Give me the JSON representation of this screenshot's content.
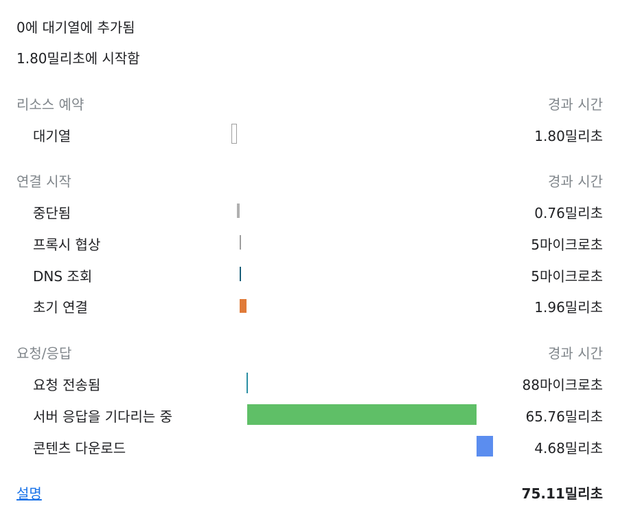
{
  "header": {
    "queued_at": "0에 대기열에 추가됨",
    "started_at": "1.80밀리초에 시작함"
  },
  "sections": [
    {
      "title": "리소스 예약",
      "time_header": "경과 시간",
      "rows": [
        {
          "label": "대기열",
          "value": "1.80밀리초"
        }
      ]
    },
    {
      "title": "연결 시작",
      "time_header": "경과 시간",
      "rows": [
        {
          "label": "중단됨",
          "value": "0.76밀리초"
        },
        {
          "label": "프록시 협상",
          "value": "5마이크로초"
        },
        {
          "label": "DNS 조회",
          "value": "5마이크로초"
        },
        {
          "label": "초기 연결",
          "value": "1.96밀리초"
        }
      ]
    },
    {
      "title": "요청/응답",
      "time_header": "경과 시간",
      "rows": [
        {
          "label": "요청 전송됨",
          "value": "88마이크로초"
        },
        {
          "label": "서버 응답을 기다리는 중",
          "value": "65.76밀리초"
        },
        {
          "label": "콘텐츠 다운로드",
          "value": "4.68밀리초"
        }
      ]
    }
  ],
  "footer": {
    "explanation_link": "설명",
    "total": "75.11밀리초"
  },
  "colors": {
    "queueing": "#9e9e9e",
    "stalled": "#b0b0b0",
    "proxy": "#9e9e9e",
    "dns": "#1a5f7a",
    "initial_connection": "#e07b39",
    "request_sent": "#2b8fa3",
    "waiting": "#5fbf67",
    "content_download": "#5b8def"
  }
}
